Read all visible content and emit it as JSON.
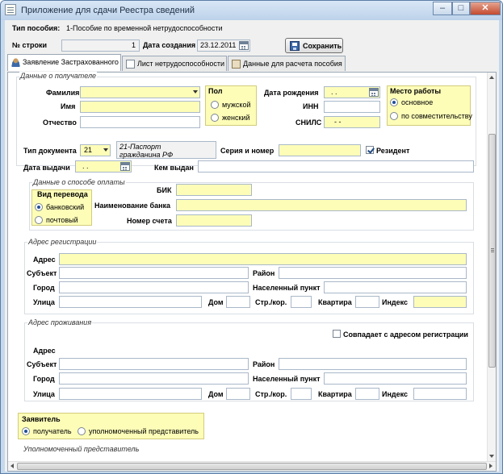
{
  "window": {
    "title": "Приложение для сдачи Реестра сведений",
    "minimize": "–",
    "maximize": "□",
    "close": "✕"
  },
  "header": {
    "benefit_type_label": "Тип пособия:",
    "benefit_type_value": "1-Пособие по временной нетрудоспособности",
    "row_label": "№ строки",
    "row_value": "1",
    "created_label": "Дата создания",
    "created_value": "23.12.2011",
    "save_label": "Сохранить"
  },
  "tabs": [
    {
      "label": "Заявление Застрахованного",
      "icon": "user-icon"
    },
    {
      "label": "Лист нетрудоспособности",
      "icon": "document-icon"
    },
    {
      "label": "Данные для расчета пособия",
      "icon": "calculator-icon"
    }
  ],
  "recipient": {
    "group_title": "Данные о получателе",
    "surname_label": "Фамилия",
    "name_label": "Имя",
    "patronymic_label": "Отчество",
    "gender_title": "Пол",
    "gender_options": [
      "мужской",
      "женский"
    ],
    "birthdate_label": "Дата рождения",
    "birthdate_value": ". .",
    "inn_label": "ИНН",
    "snils_label": "СНИЛС",
    "snils_value": "-  -",
    "workplace_title": "Место работы",
    "workplace_options": [
      "основное",
      "по совместительству"
    ],
    "doc_type_label": "Тип документа",
    "doc_type_value": "21",
    "doc_type_name": "21-Паспорт гражданина РФ",
    "series_label": "Серия и номер",
    "resident_label": "Резидент",
    "issue_date_label": "Дата выдачи",
    "issue_date_value": ". .",
    "issued_by_label": "Кем выдан"
  },
  "payment": {
    "group_title": "Данные о способе оплаты",
    "transfer_title": "Вид перевода",
    "transfer_options": [
      "банковский",
      "почтовый"
    ],
    "bik_label": "БИК",
    "bank_label": "Наименование банка",
    "account_label": "Номер счета"
  },
  "registration": {
    "group_title": "Адрес регистрации",
    "address_label": "Адрес",
    "subject_label": "Субъект",
    "district_label": "Район",
    "city_label": "Город",
    "locality_label": "Населенный пункт",
    "street_label": "Улица",
    "house_label": "Дом",
    "building_label": "Стр./кор.",
    "apartment_label": "Квартира",
    "index_label": "Индекс"
  },
  "residence": {
    "group_title": "Адрес проживания",
    "same_label": "Совпадает с адресом регистрации",
    "address_label": "Адрес",
    "subject_label": "Субъект",
    "district_label": "Район",
    "city_label": "Город",
    "locality_label": "Населенный пункт",
    "street_label": "Улица",
    "house_label": "Дом",
    "building_label": "Стр./кор.",
    "apartment_label": "Квартира",
    "index_label": "Индекс"
  },
  "applicant": {
    "title": "Заявитель",
    "options": [
      "получатель",
      "уполномоченный представитель"
    ],
    "representative_title": "Уполномоченный представитель"
  },
  "colors": {
    "required_field": "#fdfdb8",
    "frame": "#c6d8ec",
    "close_button": "#c34a2f"
  }
}
